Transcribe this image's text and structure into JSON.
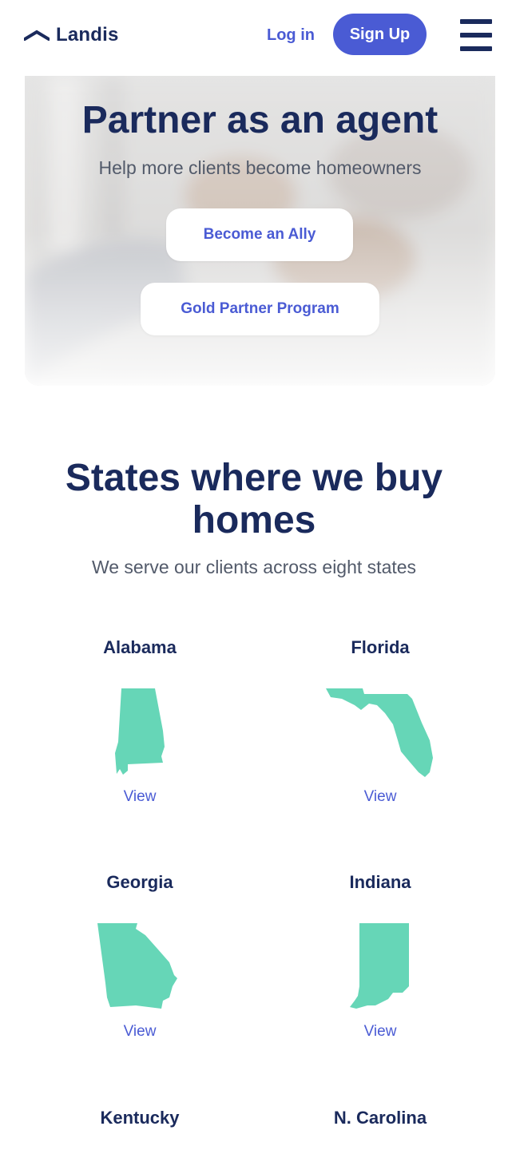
{
  "header": {
    "brand": "Landis",
    "login_label": "Log in",
    "signup_label": "Sign Up"
  },
  "hero": {
    "title": "Partner as an agent",
    "subtitle": "Help more clients become homeowners",
    "ally_button": "Become an Ally",
    "gold_button": "Gold Partner Program"
  },
  "states_section": {
    "title": "States where we buy homes",
    "subtitle": "We serve our clients across eight states",
    "view_label": "View",
    "states": [
      {
        "name": "Alabama"
      },
      {
        "name": "Florida"
      },
      {
        "name": "Georgia"
      },
      {
        "name": "Indiana"
      },
      {
        "name": "Kentucky"
      },
      {
        "name": "N. Carolina"
      }
    ],
    "map_color": "#66d6b7"
  },
  "colors": {
    "navy": "#1a2a5c",
    "accent": "#4a5bd4",
    "map": "#66d6b7"
  },
  "icons": {
    "logo": "roof-icon",
    "menu": "hamburger-menu-icon"
  }
}
